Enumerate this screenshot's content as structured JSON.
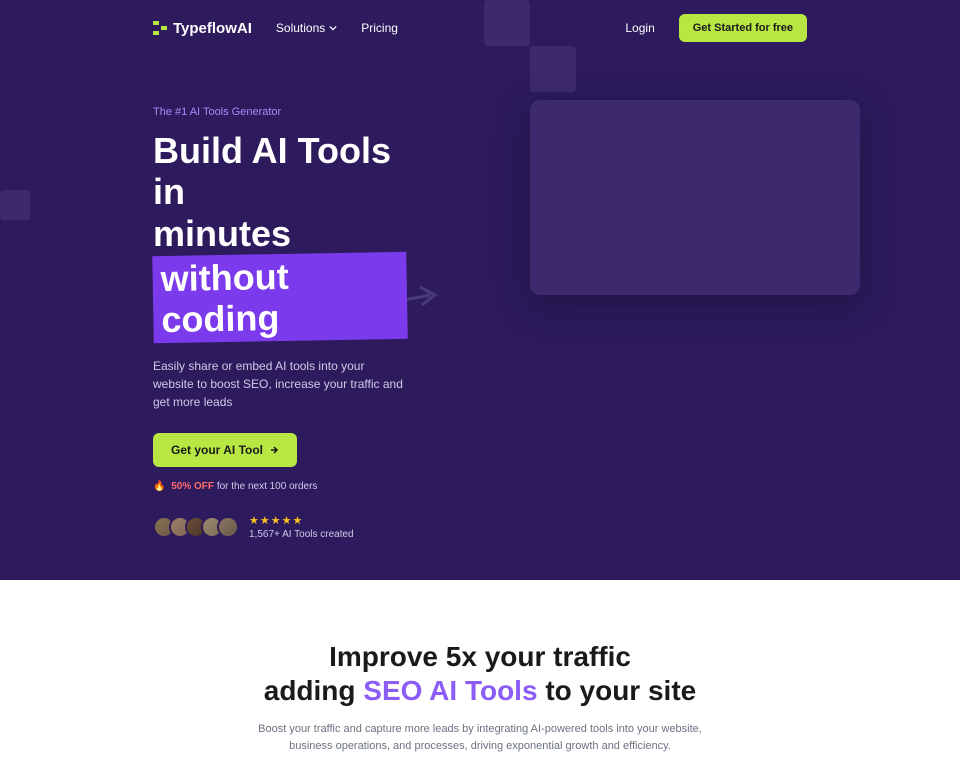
{
  "nav": {
    "brand": "TypeflowAI",
    "solutions": "Solutions",
    "pricing": "Pricing",
    "login": "Login",
    "cta": "Get Started for free"
  },
  "hero": {
    "eyebrow": "The #1 AI Tools Generator",
    "headline_1": "Build AI Tools in",
    "headline_2": "minutes",
    "headline_highlight": "without coding",
    "subhead": "Easily share or embed AI tools into your website to boost SEO, increase your traffic and get more leads",
    "cta": "Get your AI Tool",
    "offer_badge": "50% OFF",
    "offer_text": "for the next 100 orders",
    "social_count": "1,567+ AI Tools created"
  },
  "section2": {
    "title_1": "Improve 5x your traffic",
    "title_2a": "adding",
    "title_highlight": "SEO AI Tools",
    "title_2b": "to your site",
    "sub": "Boost your traffic and capture more leads by integrating AI-powered tools into your website, business operations, and processes, driving exponential growth and efficiency."
  }
}
